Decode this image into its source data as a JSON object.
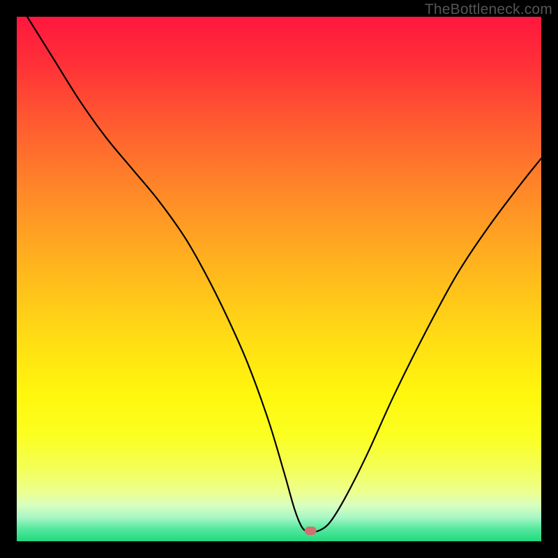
{
  "watermark": "TheBottleneck.com",
  "chart_data": {
    "type": "line",
    "title": "",
    "xlabel": "",
    "ylabel": "",
    "xlim": [
      0,
      100
    ],
    "ylim": [
      0,
      100
    ],
    "grid": false,
    "legend": false,
    "background": {
      "type": "vertical-gradient",
      "stops": [
        {
          "pos": 0.0,
          "color": "#ff173e"
        },
        {
          "pos": 0.09,
          "color": "#ff3038"
        },
        {
          "pos": 0.2,
          "color": "#ff5a30"
        },
        {
          "pos": 0.33,
          "color": "#ff8728"
        },
        {
          "pos": 0.47,
          "color": "#ffb31e"
        },
        {
          "pos": 0.6,
          "color": "#ffd915"
        },
        {
          "pos": 0.72,
          "color": "#fff70d"
        },
        {
          "pos": 0.8,
          "color": "#fbff22"
        },
        {
          "pos": 0.86,
          "color": "#f3ff56"
        },
        {
          "pos": 0.905,
          "color": "#eeff8e"
        },
        {
          "pos": 0.932,
          "color": "#d7ffc0"
        },
        {
          "pos": 0.955,
          "color": "#a7f6c5"
        },
        {
          "pos": 0.975,
          "color": "#58e9a0"
        },
        {
          "pos": 1.0,
          "color": "#1fd97d"
        }
      ]
    },
    "marker": {
      "x": 56.0,
      "y": 2.0,
      "color": "#d07070"
    },
    "series": [
      {
        "name": "curve",
        "color": "#000000",
        "width": 2.2,
        "x": [
          2,
          7,
          12,
          17,
          22,
          27,
          32,
          36,
          40,
          44,
          48,
          51,
          53,
          54.5,
          56,
          58,
          60,
          63,
          67,
          72,
          78,
          84,
          90,
          96,
          100
        ],
        "y": [
          100,
          92,
          84,
          77,
          71,
          65,
          58,
          51,
          43,
          34,
          23,
          13,
          6,
          2.5,
          1.8,
          2.2,
          4,
          9,
          17,
          28,
          40,
          51,
          60,
          68,
          73
        ]
      }
    ]
  }
}
